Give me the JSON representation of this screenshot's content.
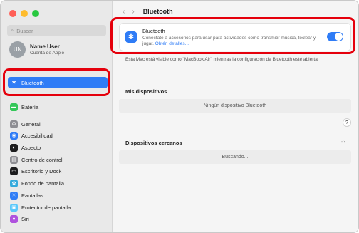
{
  "window": {
    "traffic_lights": [
      {
        "name": "close",
        "color": "#ff5f57"
      },
      {
        "name": "minimize",
        "color": "#febc2e"
      },
      {
        "name": "zoom",
        "color": "#28c840"
      }
    ]
  },
  "sidebar": {
    "search_placeholder": "Buscar",
    "user": {
      "initials": "UN",
      "name": "Name User",
      "subtitle": "Cuenta de Apple"
    },
    "items": [
      {
        "label": "Bluetooth",
        "icon": "bluetooth-icon",
        "color": "#2f7cf6",
        "selected": true
      },
      {
        "label": "Batería",
        "icon": "battery-icon",
        "color": "#34c759"
      },
      {
        "label": "General",
        "icon": "gear-icon",
        "color": "#8e8e93"
      },
      {
        "label": "Accesibilidad",
        "icon": "accessibility-icon",
        "color": "#2f7cf6"
      },
      {
        "label": "Aspecto",
        "icon": "appearance-icon",
        "color": "#1c1c1e"
      },
      {
        "label": "Centro de control",
        "icon": "control-center-icon",
        "color": "#8e8e93"
      },
      {
        "label": "Escritorio y Dock",
        "icon": "dock-icon",
        "color": "#1c1c1e"
      },
      {
        "label": "Fondo de pantalla",
        "icon": "wallpaper-icon",
        "color": "#34aadc"
      },
      {
        "label": "Pantallas",
        "icon": "displays-icon",
        "color": "#2f7cf6"
      },
      {
        "label": "Protector de pantalla",
        "icon": "screensaver-icon",
        "color": "#5ac8fa"
      },
      {
        "label": "Siri",
        "icon": "siri-icon",
        "color": "#af52de"
      }
    ]
  },
  "toolbar": {
    "title": "Bluetooth",
    "back": "‹",
    "forward": "›"
  },
  "bluetooth": {
    "title": "Bluetooth",
    "description": "Conéctate a accesorios para usar para actividades como transmitir música, teclear y jugar.",
    "link": "Obtén detalles...",
    "enabled": true
  },
  "visibility_note": "Esta Mac está visible como \"MacBook Air\" mientras la configuración de Bluetooth esté abierta.",
  "my_devices": {
    "header": "Mis dispositivos",
    "empty": "Ningún dispositivo Bluetooth"
  },
  "help": "?",
  "nearby": {
    "header": "Dispositivos cercanos",
    "status": "Buscando..."
  },
  "colors": {
    "accent": "#2f7cf6",
    "highlight": "#e5000c"
  }
}
